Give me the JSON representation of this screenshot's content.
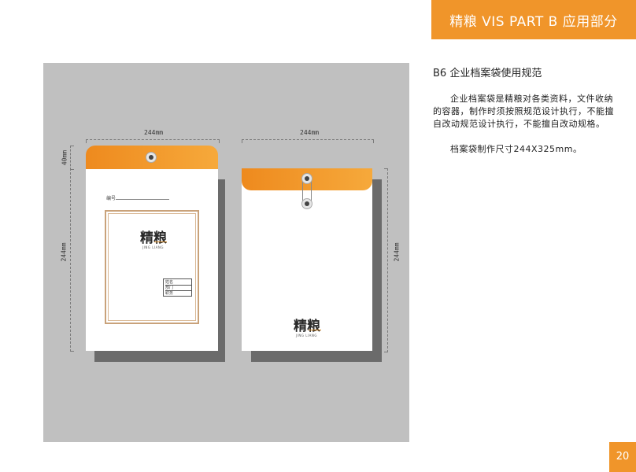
{
  "header": {
    "title": "精粮 VIS PART B 应用部分"
  },
  "section": {
    "title": "B6 企业档案袋使用规范",
    "paragraph1": "企业档案袋是精粮对各类资料，文件收纳的容器，制作时须按照规范设计执行，不能擅自改动规范设计执行，不能擅自改动规格。",
    "paragraph2": "档案袋制作尺寸244X325mm。"
  },
  "dimensions": {
    "left_width": "244mm",
    "right_width": "244mm",
    "flap_height": "40mm",
    "left_height": "244mm",
    "right_height": "244mm"
  },
  "front_bag": {
    "number_label": "编号",
    "logo_text": "精粮",
    "logo_sub": "JING LIANG",
    "form_rows": [
      "姓名",
      "部门",
      "职务"
    ]
  },
  "back_bag": {
    "logo_text": "精粮",
    "logo_sub": "JING LIANG"
  },
  "colors": {
    "accent": "#f0952a",
    "panel": "#c0c0c0",
    "shadow": "#6b6b6b"
  },
  "page_number": "20"
}
